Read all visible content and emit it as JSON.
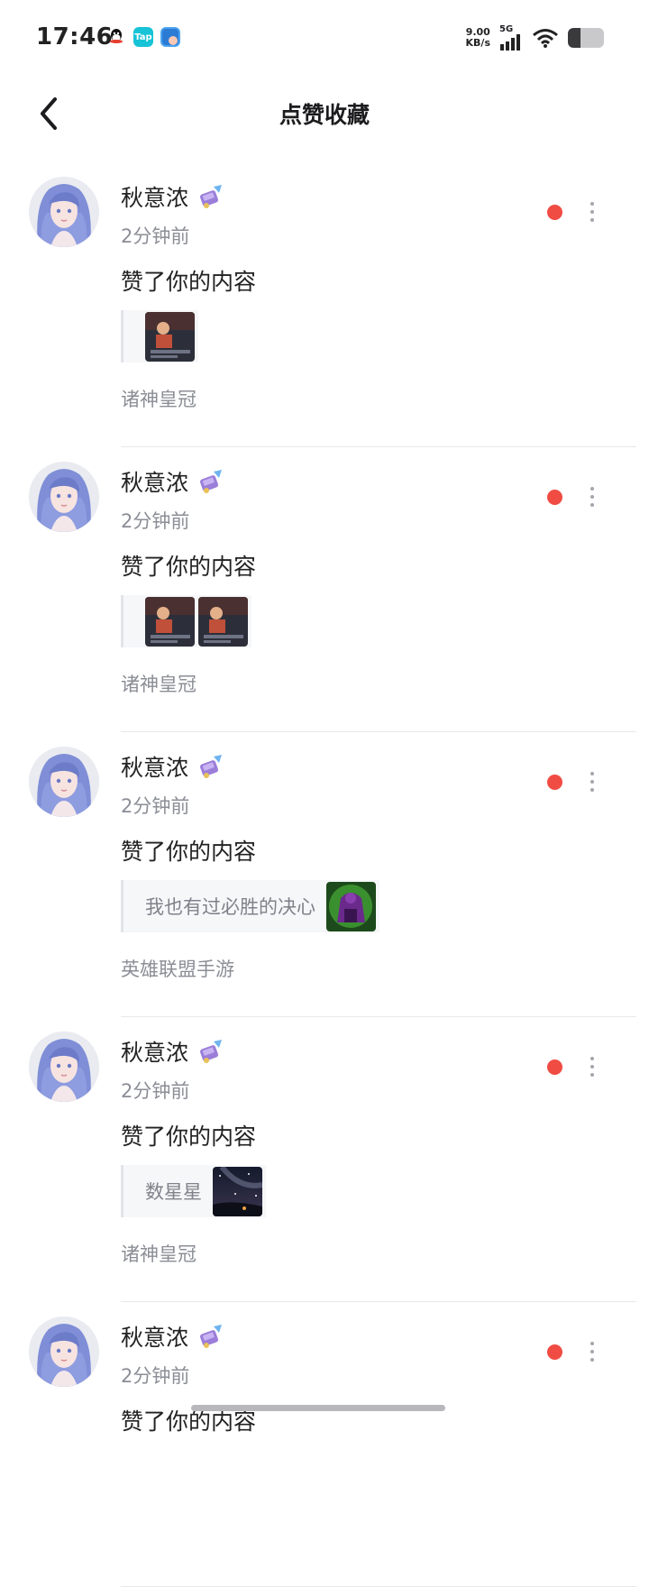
{
  "status_bar": {
    "time": "17:46",
    "app_icons": [
      {
        "name": "qq-icon",
        "label": "",
        "color": "#111111"
      },
      {
        "name": "taptap-icon",
        "label": "Tap",
        "color": "#17c3d6"
      },
      {
        "name": "app-icon",
        "label": "",
        "color": "#4aa3f0"
      }
    ],
    "net_speed_value": "9.00",
    "net_speed_unit": "KB/s",
    "network": "5G",
    "battery_level": 0.35
  },
  "header": {
    "back_icon": "chevron-left-icon",
    "title": "点赞收藏"
  },
  "notifications": [
    {
      "user": "秋意浓",
      "badge_icon": "badge-icon",
      "time": "2分钟前",
      "action": "赞了你的内容",
      "quote_text": "",
      "thumbnails": [
        "game-screenshot-thumbnail"
      ],
      "source": "诸神皇冠",
      "unread": true
    },
    {
      "user": "秋意浓",
      "badge_icon": "badge-icon",
      "time": "2分钟前",
      "action": "赞了你的内容",
      "quote_text": "",
      "thumbnails": [
        "game-screenshot-thumbnail",
        "game-screenshot-thumbnail"
      ],
      "source": "诸神皇冠",
      "unread": true
    },
    {
      "user": "秋意浓",
      "badge_icon": "badge-icon",
      "time": "2分钟前",
      "action": "赞了你的内容",
      "quote_text": "我也有过必胜的决心",
      "thumbnails": [
        "champion-art-thumbnail"
      ],
      "source": "英雄联盟手游",
      "unread": true
    },
    {
      "user": "秋意浓",
      "badge_icon": "badge-icon",
      "time": "2分钟前",
      "action": "赞了你的内容",
      "quote_text": "数星星",
      "thumbnails": [
        "starry-sky-thumbnail"
      ],
      "source": "诸神皇冠",
      "unread": true
    },
    {
      "user": "秋意浓",
      "badge_icon": "badge-icon",
      "time": "2分钟前",
      "action": "赞了你的内容",
      "quote_text": "",
      "thumbnails": [],
      "source": "",
      "unread": true
    }
  ],
  "colors": {
    "unread_dot": "#f04c43",
    "secondary_text": "#8b8e96",
    "avatar_hair": "#7f8ed6"
  }
}
